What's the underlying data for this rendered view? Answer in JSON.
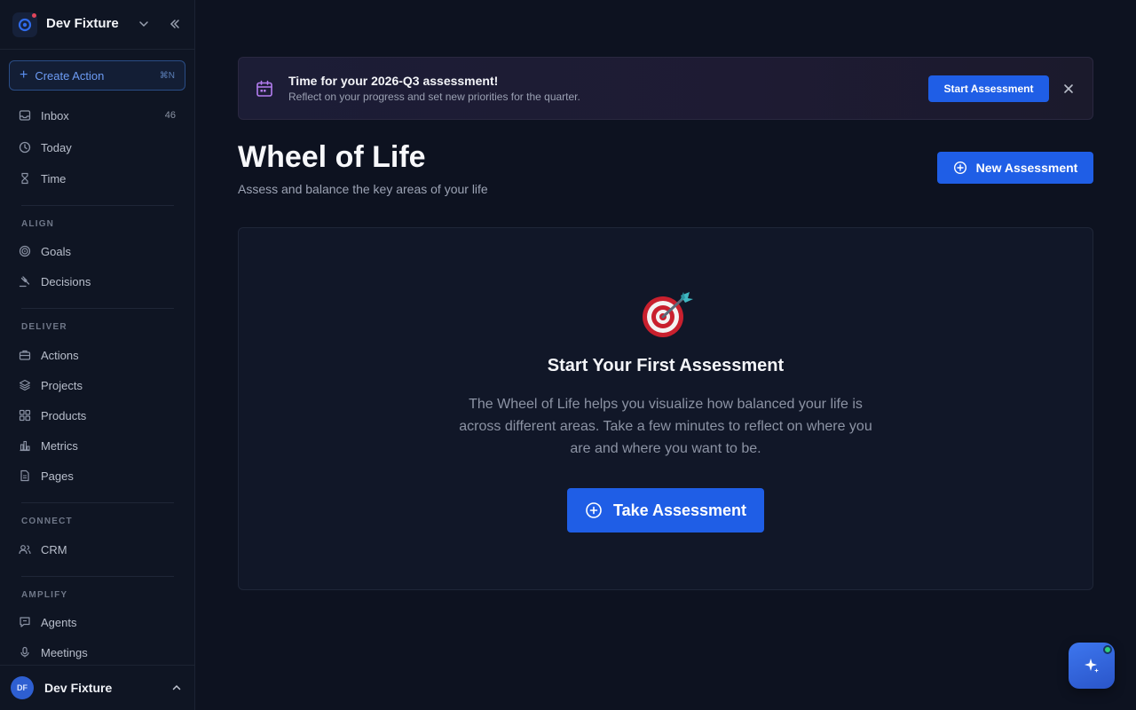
{
  "workspace": {
    "name": "Dev Fixture"
  },
  "create_action": {
    "label": "Create Action",
    "shortcut": "⌘N"
  },
  "nav_top": [
    {
      "label": "Inbox",
      "count": "46",
      "icon": "inbox-icon"
    },
    {
      "label": "Today",
      "icon": "clock-icon"
    },
    {
      "label": "Time",
      "icon": "hourglass-icon"
    }
  ],
  "sections": {
    "align": {
      "label": "ALIGN",
      "items": [
        {
          "label": "Goals",
          "icon": "target-icon"
        },
        {
          "label": "Decisions",
          "icon": "gavel-icon"
        }
      ]
    },
    "deliver": {
      "label": "DELIVER",
      "items": [
        {
          "label": "Actions",
          "icon": "briefcase-icon"
        },
        {
          "label": "Projects",
          "icon": "layers-icon"
        },
        {
          "label": "Products",
          "icon": "grid-icon"
        },
        {
          "label": "Metrics",
          "icon": "bar-chart-icon"
        },
        {
          "label": "Pages",
          "icon": "document-icon"
        }
      ]
    },
    "connect": {
      "label": "CONNECT",
      "items": [
        {
          "label": "CRM",
          "icon": "users-icon"
        }
      ]
    },
    "amplify": {
      "label": "AMPLIFY",
      "items": [
        {
          "label": "Agents",
          "icon": "chat-icon"
        },
        {
          "label": "Meetings",
          "icon": "microphone-icon"
        }
      ]
    }
  },
  "user": {
    "initials": "DF",
    "name": "Dev Fixture"
  },
  "banner": {
    "title": "Time for your 2026-Q3 assessment!",
    "subtitle": "Reflect on your progress and set new priorities for the quarter.",
    "button": "Start Assessment"
  },
  "page": {
    "title": "Wheel of Life",
    "subtitle": "Assess and balance the key areas of your life",
    "new_button": "New Assessment"
  },
  "empty_state": {
    "icon": "dart-target-icon",
    "title": "Start Your First Assessment",
    "description": "The Wheel of Life helps you visualize how balanced your life is across different areas. Take a few minutes to reflect on where you are and where you want to be.",
    "button": "Take Assessment"
  },
  "colors": {
    "accent": "#1f5ee6",
    "background": "#0d1220",
    "sidebar": "#0f1523",
    "status_online": "#2fd07a"
  }
}
